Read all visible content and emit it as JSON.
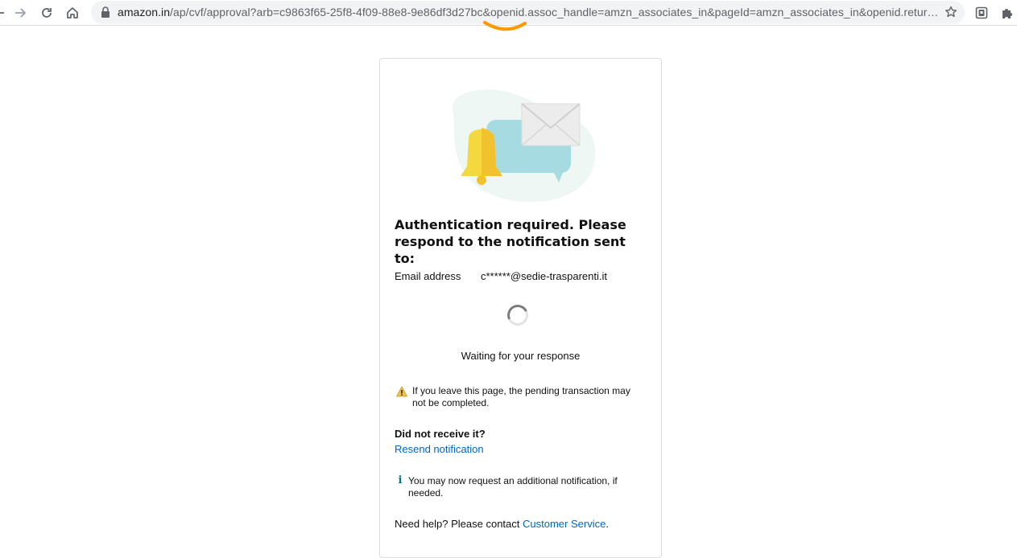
{
  "browser": {
    "url_host": "amazon.in",
    "url_path": "/ap/cvf/approval?arb=c9863f65-25f8-4f09-88e8-9e86df3d27bc&openid.assoc_handle=amzn_associates_in&pageId=amzn_associates_in&openid.return...",
    "icons": [
      "back-arrow-icon",
      "forward-arrow-icon",
      "reload-icon",
      "home-icon",
      "lock-icon",
      "star-icon",
      "extension-icon",
      "puzzle-icon"
    ]
  },
  "card": {
    "heading": "Authentication required. Please respond to the notification sent to:",
    "email_label": "Email address",
    "email_value": "c******@sedie-trasparenti.it",
    "waiting_text": "Waiting for your response",
    "warning_text": "If you leave this page, the pending transaction may not be completed.",
    "not_received": "Did not receive it?",
    "resend_link": "Resend notification",
    "info_text": "You may now request an additional notification, if needed.",
    "help_prefix": "Need help? Please contact ",
    "help_link": "Customer Service",
    "help_suffix": "."
  },
  "colors": {
    "link": "#0066c0",
    "brand_orange": "#ff9900",
    "warning": "#f0c14b",
    "info": "#007185"
  }
}
